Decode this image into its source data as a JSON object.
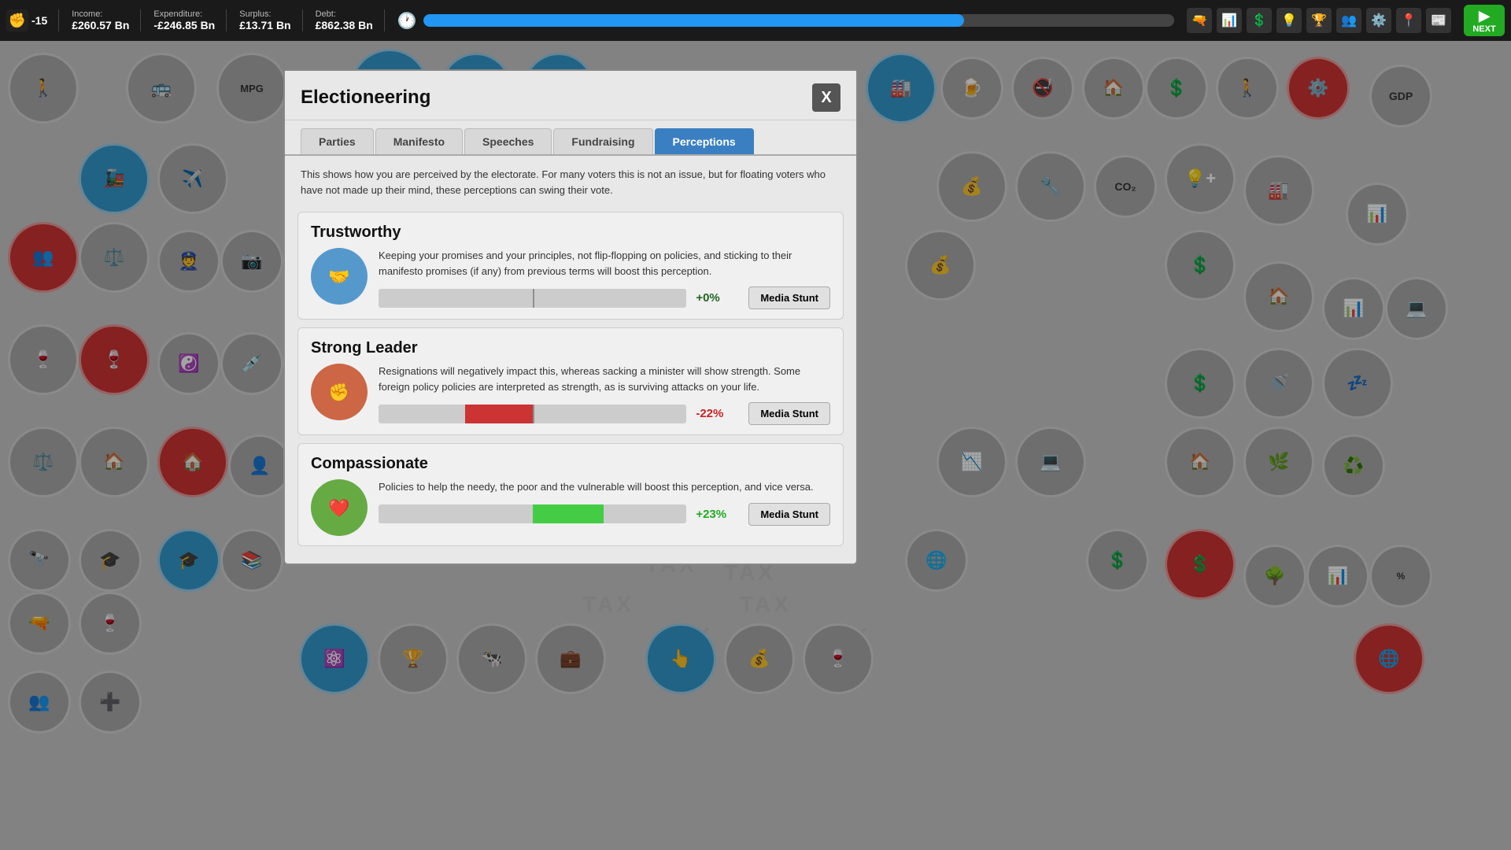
{
  "topbar": {
    "anger_label": "-15",
    "income_label": "Income:",
    "income_value": "£260.57 Bn",
    "expenditure_label": "Expenditure:",
    "expenditure_value": "-£246.85 Bn",
    "surplus_label": "Surplus:",
    "surplus_value": "£13.71 Bn",
    "debt_label": "Debt:",
    "debt_value": "£862.38 Bn",
    "progress_pct": 72,
    "next_label": "NEXT"
  },
  "modal": {
    "title": "Electioneering",
    "close_label": "X",
    "description": "This shows how you are perceived by the electorate. For many voters this is not an issue, but for floating voters who have not made up their mind, these perceptions can swing their vote.",
    "tabs": [
      {
        "label": "Parties",
        "active": false
      },
      {
        "label": "Manifesto",
        "active": false
      },
      {
        "label": "Speeches",
        "active": false
      },
      {
        "label": "Fundraising",
        "active": false
      },
      {
        "label": "Perceptions",
        "active": true
      }
    ],
    "perceptions": [
      {
        "id": "trustworthy",
        "title": "Trustworthy",
        "description": "Keeping your promises and your principles, not flip-flopping on policies, and sticking to their manifesto promises (if any) from previous terms will boost this perception.",
        "value_pct": 0,
        "value_label": "+0%",
        "value_sign": "neutral",
        "bar_dir": "none",
        "media_stunt_label": "Media Stunt"
      },
      {
        "id": "strong-leader",
        "title": "Strong Leader",
        "description": "Resignations will negatively impact this, whereas sacking a minister will show strength. Some foreign policy policies are interpreted as strength, as is surviving attacks on your life.",
        "value_pct": -22,
        "value_label": "-22%",
        "value_sign": "negative",
        "bar_dir": "left",
        "media_stunt_label": "Media Stunt"
      },
      {
        "id": "compassionate",
        "title": "Compassionate",
        "description": "Policies to help the needy, the poor and the vulnerable will boost this perception, and vice versa.",
        "value_pct": 23,
        "value_label": "+23%",
        "value_sign": "positive",
        "bar_dir": "right",
        "media_stunt_label": "Media Stunt"
      }
    ]
  }
}
